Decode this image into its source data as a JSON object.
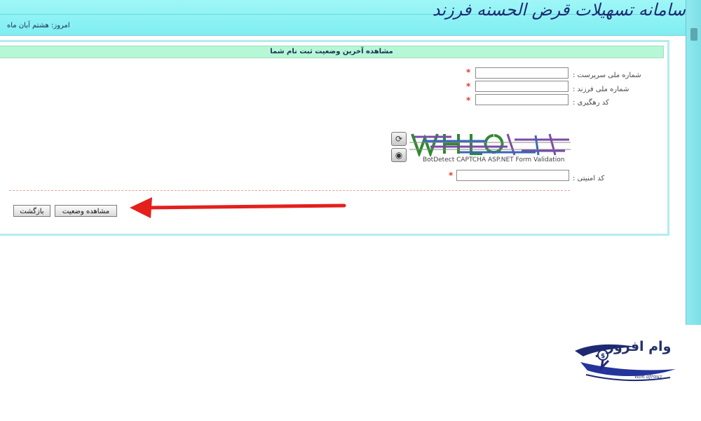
{
  "header": {
    "brand_text": "سامانه تسهیلات قرض الحسنه فرزند",
    "today_text": "امروز: هشتم آبان ماه"
  },
  "panel": {
    "title": "مشاهده آخرین وضعیت ثبت نام شما"
  },
  "form": {
    "fields": [
      {
        "label": "شماره ملی سرپرست :",
        "value": "",
        "required_mark": "*"
      },
      {
        "label": "شماره ملی فرزند :",
        "value": "",
        "required_mark": "*"
      },
      {
        "label": "کد رهگیری :",
        "value": "",
        "required_mark": "*"
      }
    ],
    "captcha": {
      "caption": "BotDetect CAPTCHA ASP.NET Form Validation",
      "security_label": "کد امنیتی :",
      "security_value": "",
      "required_mark": "*"
    }
  },
  "buttons": {
    "view_status": "مشاهده وضعیت",
    "back": "بازگشت"
  },
  "watermark": {
    "text": "وام افروز",
    "sub": "vam afrouz"
  },
  "colors": {
    "topbar": "#8ff2f4",
    "panel_header": "#b6f7d5",
    "arrow": "#e3201c",
    "required": "#e33a2a"
  }
}
